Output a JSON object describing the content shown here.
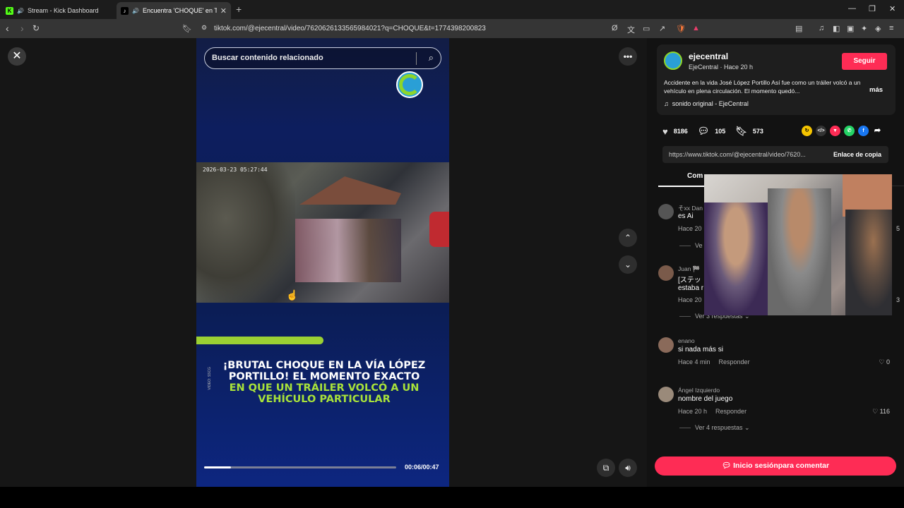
{
  "browser": {
    "tabs": [
      {
        "title": "Stream - Kick Dashboard",
        "favicon": "kick-icon"
      },
      {
        "title": "Encuentra 'CHOQUE' en TikTok",
        "favicon": "tiktok-icon"
      }
    ],
    "new_tab_label": "+",
    "url": "tiktok.com/@ejecentral/video/7620626133565984021?q=CHOQUE&t=1774398200823"
  },
  "video": {
    "search_placeholder": "Buscar contenido relacionado",
    "cctv_timestamp": "2026-03-23  05:27:44",
    "side_tag": "VIDEO: SSCG",
    "headline_white": "¡BRUTAL CHOQUE EN LA VÍA LÓPEZ PORTILLO! EL MOMENTO EXACTO",
    "headline_green": "EN QUE UN TRÁILER VOLCÓ A UN VEHÍCULO PARTICULAR",
    "time": "00:06/00:47",
    "progress_fraction": 0.14
  },
  "post": {
    "author": "ejecentral",
    "author_meta": "EjeCentral · Hace 20 h",
    "follow_label": "Seguir",
    "description": "Accidente en la vida José López Portillo Así fue como un tráiler volcó a un vehículo en plena circulación. El momento quedó...",
    "more_label": "más",
    "sound": "sonido original - EjeCentral",
    "likes": "8186",
    "comments": "105",
    "saves": "573",
    "share_url": "https://www.tiktok.com/@ejecentral/video/7620...",
    "copy_label": "Enlace de copia",
    "comments_tab": "Com"
  },
  "comments": [
    {
      "name": "そxx Dan",
      "text": "es Ai",
      "time": "Hace 20",
      "reply": "",
      "likes": "5",
      "replies": "Ve",
      "avatar_color": "#555555"
    },
    {
      "name": "Juan 🏁",
      "text": "[ステッ",
      "text2": "estaba r",
      "time": "Hace 20",
      "reply": "",
      "likes": "3",
      "replies": "Ver 3 respuestas ⌄",
      "avatar_color": "#7a5a4a"
    },
    {
      "name": "enano",
      "text": "si nada más si",
      "time": "Hace 4 min",
      "reply": "Responder",
      "likes": "♡ 0",
      "replies": "",
      "avatar_color": "#8a6a5a"
    },
    {
      "name": "Ángel Izquierdo",
      "text": "nombre del juego",
      "time": "Hace 20 h",
      "reply": "Responder",
      "likes": "♡ 116",
      "replies": "Ver 4 respuestas ⌄",
      "avatar_color": "#9a8a7a"
    }
  ],
  "login_label": "Inicio sesiónpara comentar",
  "colors": {
    "accent": "#fe2c55",
    "brand_green": "#a8e23a",
    "panel_bg": "#121212"
  }
}
